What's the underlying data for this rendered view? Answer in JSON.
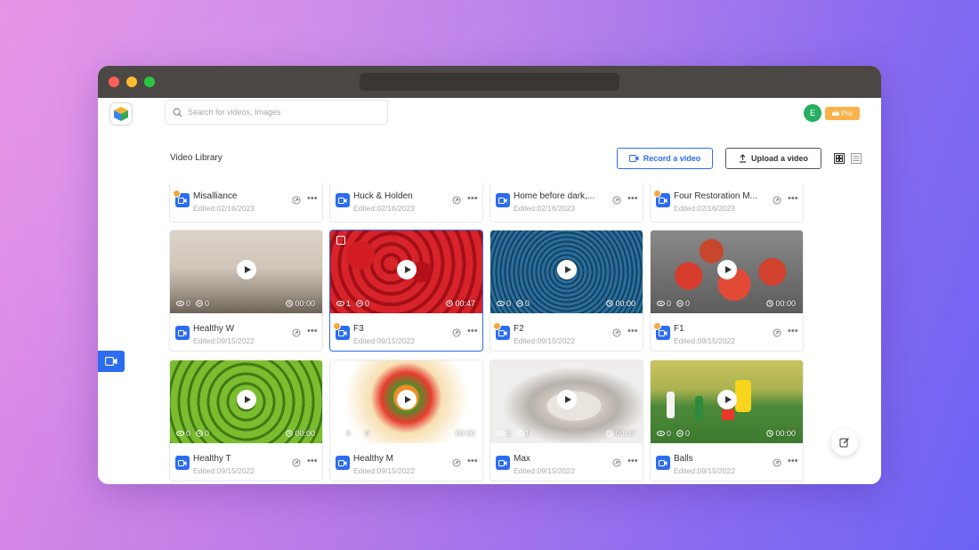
{
  "app": {
    "search_placeholder": "Search for videos, Images",
    "user_initial": "E",
    "plan_label": "Pro",
    "page_title": "Video Library",
    "record_label": "Record a video",
    "upload_label": "Upload a video"
  },
  "colors": {
    "accent": "#2c6cf1",
    "pro": "#f9b24c",
    "avatar": "#27ae60"
  },
  "top_row": [
    {
      "name": "Misalliance",
      "date": "Edited:02/16/2023",
      "badge": true
    },
    {
      "name": "Huck & Holden",
      "date": "Edited:02/16/2023",
      "badge": false
    },
    {
      "name": "Home before dark,...",
      "date": "Edited:02/16/2023",
      "badge": false
    },
    {
      "name": "Four Restoration M...",
      "date": "Edited:02/16/2023",
      "badge": true
    }
  ],
  "row2": [
    {
      "name": "Healthy W",
      "date": "Edited:09/15/2022",
      "views": "0",
      "comments": "0",
      "duration": "00:00",
      "badge": false
    },
    {
      "name": "F3",
      "date": "Edited:09/15/2022",
      "views": "1",
      "comments": "0",
      "duration": "00:47",
      "badge": true
    },
    {
      "name": "F2",
      "date": "Edited:09/15/2022",
      "views": "0",
      "comments": "0",
      "duration": "00:00",
      "badge": true
    },
    {
      "name": "F1",
      "date": "Edited:09/15/2022",
      "views": "0",
      "comments": "0",
      "duration": "00:00",
      "badge": true
    }
  ],
  "row3": [
    {
      "name": "Healthy T",
      "date": "Edited:09/15/2022",
      "views": "0",
      "comments": "0",
      "duration": "00:00"
    },
    {
      "name": "Healthy M",
      "date": "Edited:09/15/2022",
      "views": "0",
      "comments": "0",
      "duration": "00:00"
    },
    {
      "name": "Max",
      "date": "Edited:09/15/2022",
      "views": "1",
      "comments": "1",
      "duration": "00:47"
    },
    {
      "name": "Balls",
      "date": "Edited:09/15/2022",
      "views": "0",
      "comments": "0",
      "duration": "00:00"
    }
  ],
  "icons": {
    "search": "search-icon",
    "video": "video-icon",
    "upload": "upload-icon",
    "grid": "grid-view-icon",
    "list": "list-view-icon",
    "share": "share-icon",
    "more": "more-icon",
    "eye": "eye-icon",
    "comment": "comment-icon",
    "clock": "clock-icon",
    "edit": "edit-icon",
    "crown": "crown-icon"
  }
}
